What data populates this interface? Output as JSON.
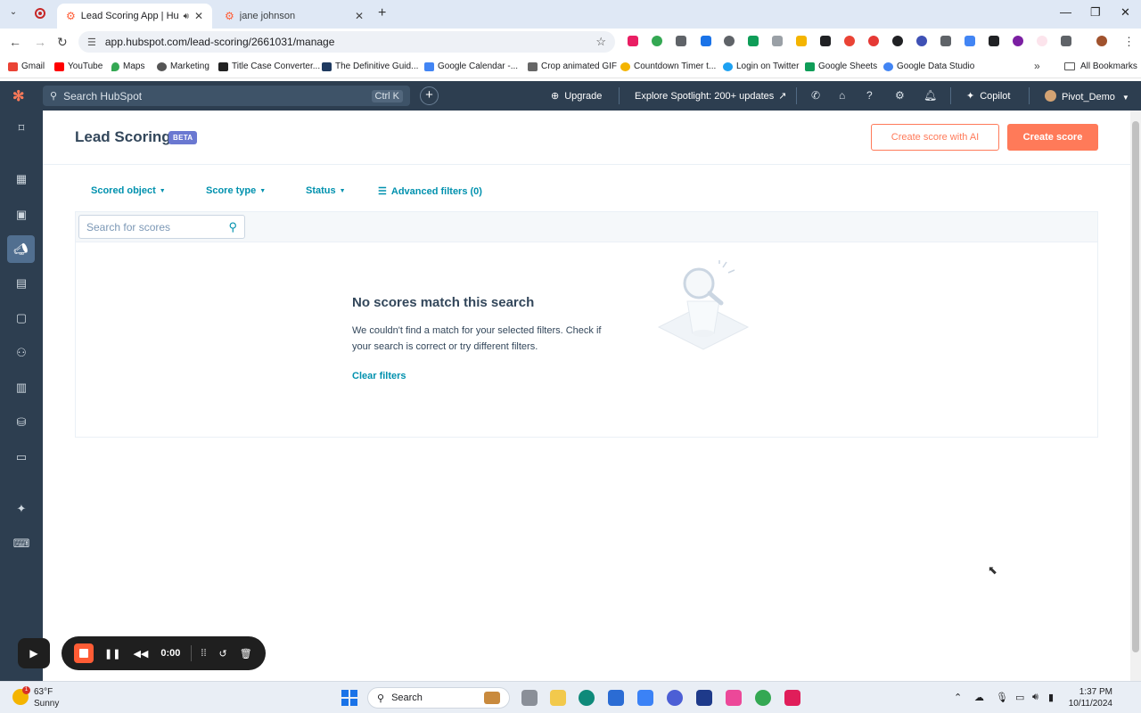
{
  "browser": {
    "tabs": [
      {
        "title": "Lead Scoring App | HubSpot",
        "active": true
      },
      {
        "title": "jane johnson",
        "active": false
      }
    ],
    "url": "app.hubspot.com/lead-scoring/2661031/manage",
    "bookmarks": [
      {
        "label": "Gmail",
        "color": "#ea4335"
      },
      {
        "label": "YouTube",
        "color": "#ff0000"
      },
      {
        "label": "Maps",
        "color": "#34a853"
      },
      {
        "label": "Marketing",
        "color": "#555555"
      },
      {
        "label": "Title Case Converter...",
        "color": "#222222"
      },
      {
        "label": "The Definitive Guid...",
        "color": "#1f3a60"
      },
      {
        "label": "Google Calendar -...",
        "color": "#4285f4"
      },
      {
        "label": "Crop animated GIF",
        "color": "#666666"
      },
      {
        "label": "Countdown Timer t...",
        "color": "#f4b400"
      },
      {
        "label": "Login on Twitter",
        "color": "#1da1f2"
      },
      {
        "label": "Google Sheets",
        "color": "#0f9d58"
      },
      {
        "label": "Google Data Studio",
        "color": "#4285f4"
      }
    ],
    "all_bookmarks": "All Bookmarks"
  },
  "hubspot_nav": {
    "search_placeholder": "Search HubSpot",
    "search_shortcut": "Ctrl K",
    "upgrade": "Upgrade",
    "spotlight": "Explore Spotlight: 200+ updates",
    "copilot": "Copilot",
    "account": "Pivot_Demo"
  },
  "page": {
    "title": "Lead Scoring",
    "badge": "BETA",
    "create_ai_label": "Create score with AI",
    "create_label": "Create score"
  },
  "filters": {
    "scored_object": "Scored object",
    "score_type": "Score type",
    "status": "Status",
    "advanced": "Advanced filters (0)"
  },
  "table": {
    "search_placeholder": "Search for scores"
  },
  "empty_state": {
    "title": "No scores match this search",
    "text": "We couldn't find a match for your selected filters. Check if your search is correct or try different filters.",
    "clear_label": "Clear filters"
  },
  "recorder": {
    "time": "0:00"
  },
  "taskbar": {
    "temperature": "63°F",
    "condition": "Sunny",
    "weather_badge": "1",
    "search_label": "Search",
    "time": "1:37 PM",
    "date": "10/11/2024"
  },
  "colors": {
    "hubspot_nav": "#2d3e50",
    "accent_orange": "#ff7a59",
    "link_teal": "#0091ae",
    "beta_badge": "#6a78d1"
  }
}
